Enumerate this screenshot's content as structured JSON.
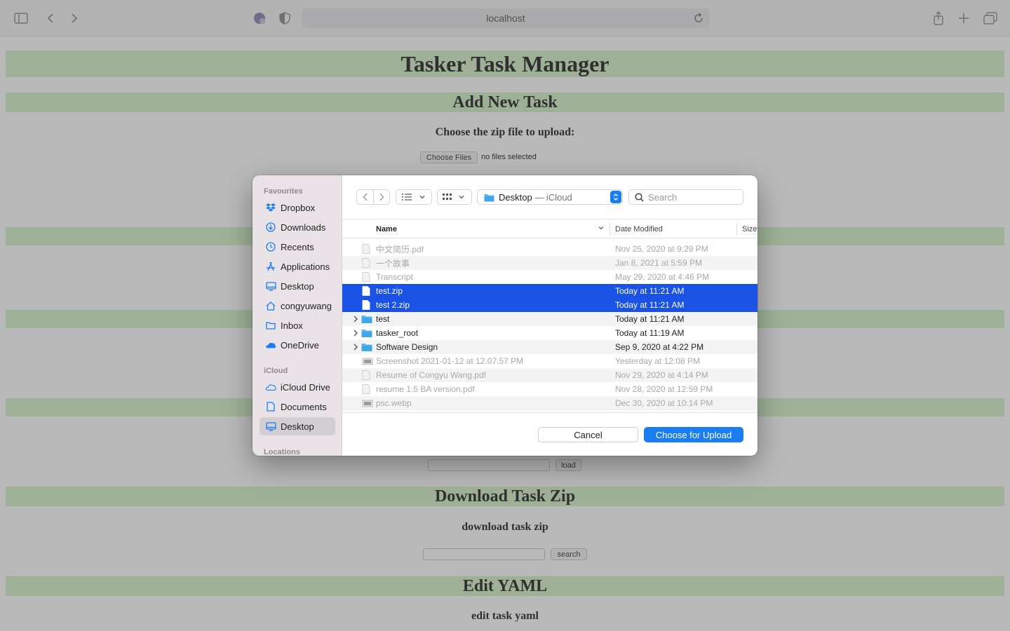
{
  "browser": {
    "address": "localhost"
  },
  "page": {
    "title": "Tasker Task Manager",
    "add_section": {
      "heading": "Add New Task",
      "prompt": "Choose the zip file to upload:",
      "choose_label": "Choose Files",
      "no_files": "no files selected"
    },
    "load_button": "load",
    "download_section": {
      "heading": "Download Task Zip",
      "prompt": "download task zip",
      "search_button": "search"
    },
    "yaml_section": {
      "heading": "Edit YAML",
      "prompt": "edit task yaml"
    }
  },
  "dialog": {
    "sidebar": {
      "favourites_heading": "Favourites",
      "favourites": [
        {
          "label": "Dropbox",
          "icon": "dropbox-icon"
        },
        {
          "label": "Downloads",
          "icon": "downloads-icon"
        },
        {
          "label": "Recents",
          "icon": "recents-icon"
        },
        {
          "label": "Applications",
          "icon": "applications-icon"
        },
        {
          "label": "Desktop",
          "icon": "desktop-icon"
        },
        {
          "label": "congyuwang",
          "icon": "home-icon"
        },
        {
          "label": "Inbox",
          "icon": "folder-icon"
        },
        {
          "label": "OneDrive",
          "icon": "cloud-icon"
        }
      ],
      "icloud_heading": "iCloud",
      "icloud": [
        {
          "label": "iCloud Drive",
          "icon": "icloud-icon"
        },
        {
          "label": "Documents",
          "icon": "document-icon"
        },
        {
          "label": "Desktop",
          "icon": "desktop-icon",
          "selected": true
        }
      ],
      "locations_heading": "Locations"
    },
    "location": "Desktop",
    "location_suffix": " — iCloud",
    "search_placeholder": "Search",
    "columns": {
      "name": "Name",
      "date": "Date Modified",
      "size": "Size"
    },
    "files": [
      {
        "name": "中文简历.pdf",
        "date": "Nov 25, 2020 at 9:29 PM",
        "state": "dis",
        "kind": "doc"
      },
      {
        "name": "一个故事",
        "date": "Jan 8, 2021 at 5:59 PM",
        "state": "dis",
        "kind": "doc"
      },
      {
        "name": "Transcript",
        "date": "May 29, 2020 at 4:46 PM",
        "state": "dis",
        "kind": "doc"
      },
      {
        "name": "test.zip",
        "date": "Today at 11:21 AM",
        "state": "sel",
        "kind": "doc"
      },
      {
        "name": "test 2.zip",
        "date": "Today at 11:21 AM",
        "state": "sel",
        "kind": "doc"
      },
      {
        "name": "test",
        "date": "Today at 11:21 AM",
        "state": "norm",
        "kind": "folder"
      },
      {
        "name": "tasker_root",
        "date": "Today at 11:19 AM",
        "state": "norm",
        "kind": "folder"
      },
      {
        "name": "Software Design",
        "date": "Sep 9, 2020 at 4:22 PM",
        "state": "norm",
        "kind": "folder"
      },
      {
        "name": "Screenshot 2021-01-12 at 12.07.57 PM",
        "date": "Yesterday at 12:08 PM",
        "state": "dis",
        "kind": "image"
      },
      {
        "name": "Resume of Congyu Wang.pdf",
        "date": "Nov 29, 2020 at 4:14 PM",
        "state": "dis",
        "kind": "doc"
      },
      {
        "name": "resume 1.5 BA version.pdf",
        "date": "Nov 28, 2020 at 12:59 PM",
        "state": "dis",
        "kind": "doc"
      },
      {
        "name": "psc.webp",
        "date": "Dec 30, 2020 at 10:14 PM",
        "state": "dis",
        "kind": "image"
      }
    ],
    "cancel_label": "Cancel",
    "choose_label": "Choose for Upload"
  },
  "colors": {
    "banner": "#d3f2c8",
    "accent": "#1a7ef2",
    "selection": "#1a52e6"
  }
}
